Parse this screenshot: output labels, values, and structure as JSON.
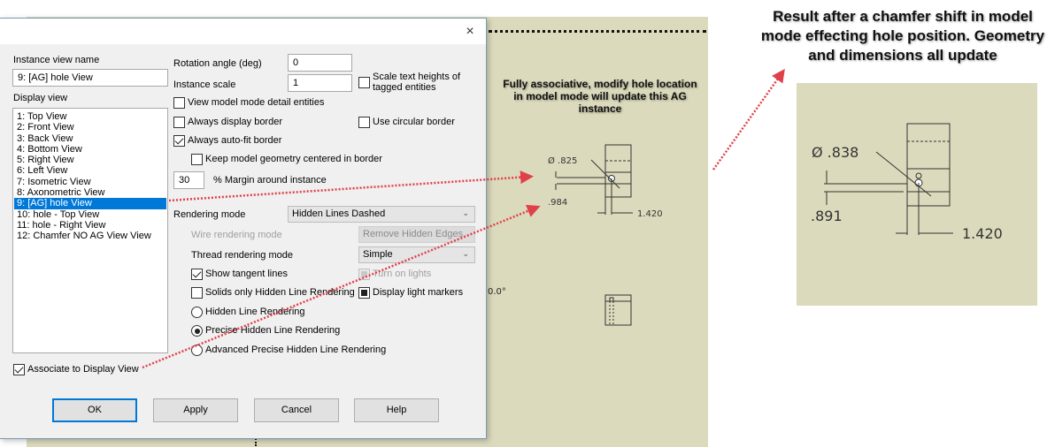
{
  "dialog": {
    "close_icon": "×",
    "instance_view_name_label": "Instance view name",
    "instance_view_name_value": "9: [AG] hole View",
    "display_view_label": "Display view",
    "display_views": [
      {
        "label": "1: Top View",
        "selected": false
      },
      {
        "label": "2: Front View",
        "selected": false
      },
      {
        "label": "3: Back View",
        "selected": false
      },
      {
        "label": "4: Bottom View",
        "selected": false
      },
      {
        "label": "5: Right View",
        "selected": false
      },
      {
        "label": "6: Left View",
        "selected": false
      },
      {
        "label": "7: Isometric View",
        "selected": false
      },
      {
        "label": "8: Axonometric View",
        "selected": false
      },
      {
        "label": "9: [AG] hole View",
        "selected": true
      },
      {
        "label": "10: hole - Top View",
        "selected": false
      },
      {
        "label": "11: hole - Right View",
        "selected": false
      },
      {
        "label": "12: Chamfer NO AG View View",
        "selected": false
      }
    ],
    "rotation_angle_label": "Rotation angle (deg)",
    "rotation_angle_value": "0",
    "instance_scale_label": "Instance scale",
    "instance_scale_value": "1",
    "scale_text_heights_label_1": "Scale text heights of",
    "scale_text_heights_label_2": "tagged entities",
    "scale_text_heights_checked": false,
    "view_model_mode_label": "View model mode detail entities",
    "view_model_mode_checked": false,
    "always_display_border_label": "Always display border",
    "always_display_border_checked": false,
    "use_circular_border_label": "Use circular border",
    "use_circular_border_checked": false,
    "always_autofit_label": "Always auto-fit border",
    "always_autofit_checked": true,
    "keep_centered_label": "Keep model geometry centered in border",
    "keep_centered_checked": false,
    "margin_value": "30",
    "margin_label": "% Margin around instance",
    "rendering_mode_label": "Rendering mode",
    "rendering_mode_value": "Hidden Lines Dashed",
    "wire_rendering_label": "Wire rendering mode",
    "wire_rendering_value": "Remove Hidden Edges",
    "thread_rendering_label": "Thread rendering mode",
    "thread_rendering_value": "Simple",
    "show_tangent_label": "Show tangent lines",
    "show_tangent_checked": true,
    "turn_on_lights_label": "Turn on lights",
    "solids_only_label": "Solids only Hidden Line Rendering",
    "solids_only_checked": false,
    "display_light_markers_label": "Display light markers",
    "radio_options": [
      {
        "label": "Hidden Line Rendering",
        "checked": false
      },
      {
        "label": "Precise Hidden Line Rendering",
        "checked": true
      },
      {
        "label": "Advanced Precise Hidden Line Rendering",
        "checked": false
      }
    ],
    "associate_label": "Associate to Display View",
    "associate_checked": true,
    "buttons": {
      "ok": "OK",
      "apply": "Apply",
      "cancel": "Cancel",
      "help": "Help"
    }
  },
  "canvas": {
    "angle_text": "0.0°",
    "drawing_before": {
      "diameter": "Ø .825",
      "vertical_dim": ".984",
      "horizontal_dim": "1.420"
    }
  },
  "annotations": {
    "callout_1": "Fully associative, modify hole location in model mode will update this AG instance",
    "callout_2": "Result after a chamfer shift in model mode effecting hole position. Geometry and dimensions all update",
    "drawing_after": {
      "diameter": "Ø .838",
      "vertical_dim": ".891",
      "horizontal_dim": "1.420"
    },
    "arrow_color": "#e0404a"
  }
}
